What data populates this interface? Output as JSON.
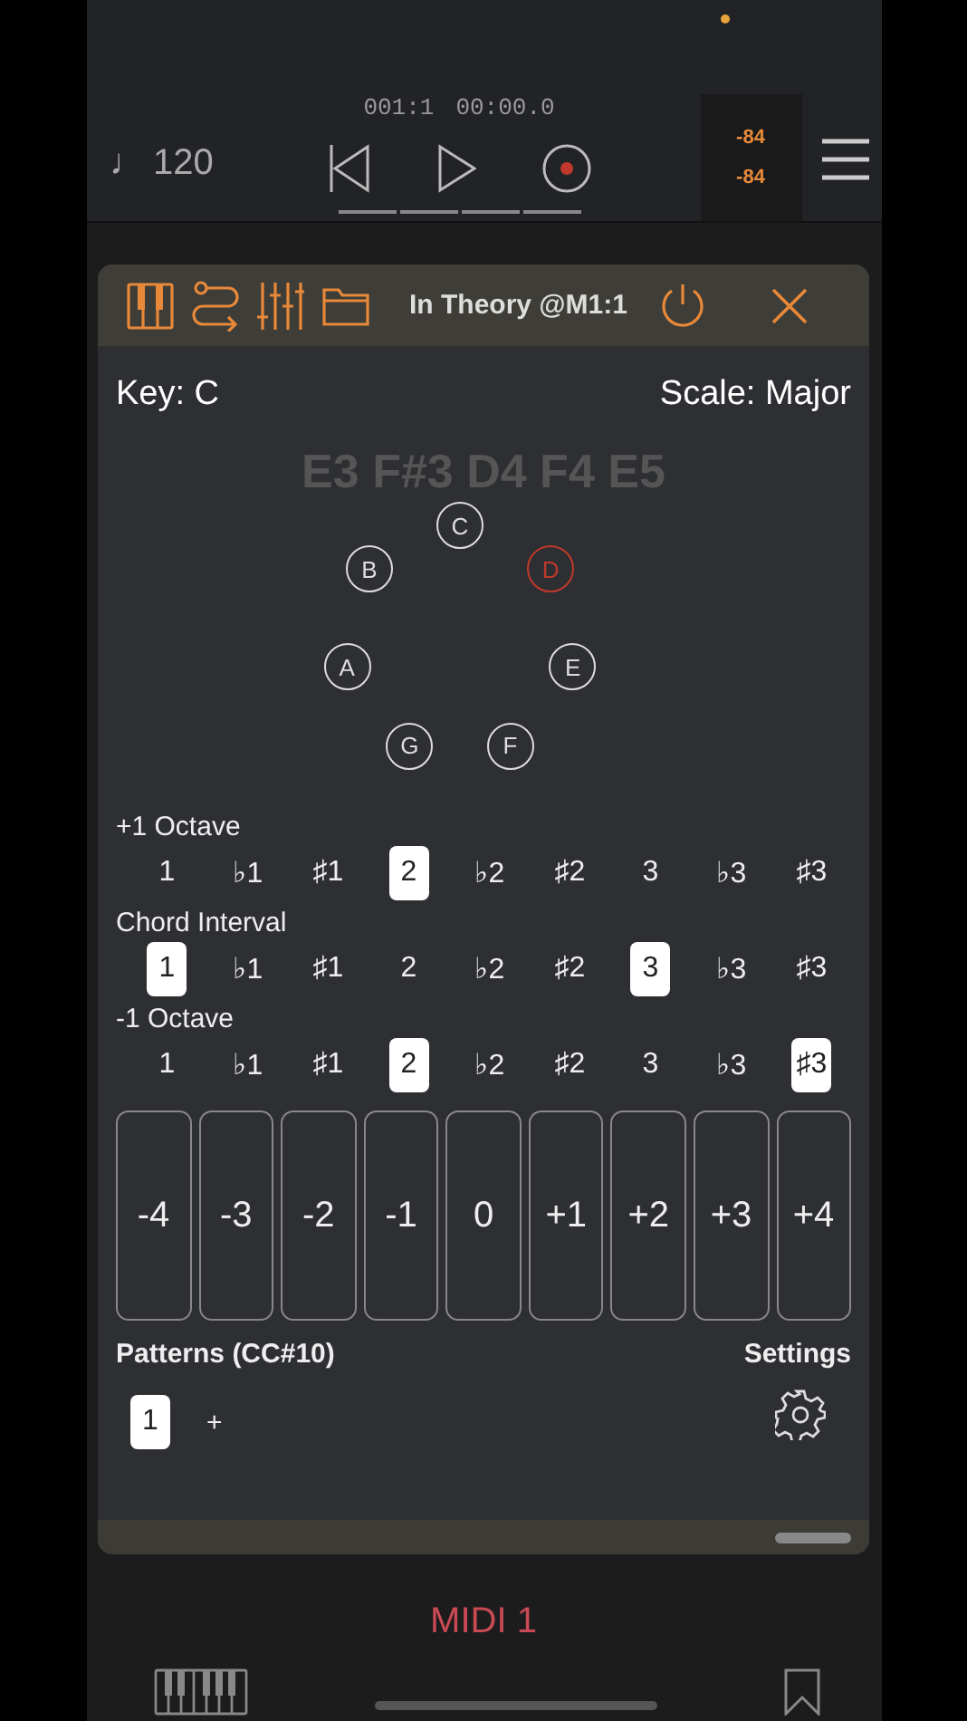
{
  "transport": {
    "tempo_symbol": "♩",
    "tempo": "120",
    "position": "001:1",
    "time": "00:00.0",
    "meters": [
      "-84",
      "-84"
    ]
  },
  "plugin": {
    "title": "In Theory @M1:1",
    "key": "Key: C",
    "scale": "Scale: Major",
    "chord_notes": "E3 F#3 D4 F4 E5",
    "circle": [
      {
        "note": "C",
        "highlighted": false
      },
      {
        "note": "D",
        "highlighted": true
      },
      {
        "note": "E",
        "highlighted": false
      },
      {
        "note": "F",
        "highlighted": false
      },
      {
        "note": "G",
        "highlighted": false
      },
      {
        "note": "A",
        "highlighted": false
      },
      {
        "note": "B",
        "highlighted": false
      }
    ],
    "interval_rows": [
      {
        "label": "+1 Octave",
        "options": [
          {
            "label": "1",
            "selected": false
          },
          {
            "label": "♭1",
            "selected": false
          },
          {
            "label": "♯1",
            "selected": false
          },
          {
            "label": "2",
            "selected": true
          },
          {
            "label": "♭2",
            "selected": false
          },
          {
            "label": "♯2",
            "selected": false
          },
          {
            "label": "3",
            "selected": false
          },
          {
            "label": "♭3",
            "selected": false
          },
          {
            "label": "♯3",
            "selected": false
          }
        ]
      },
      {
        "label": "Chord Interval",
        "options": [
          {
            "label": "1",
            "selected": true
          },
          {
            "label": "♭1",
            "selected": false
          },
          {
            "label": "♯1",
            "selected": false
          },
          {
            "label": "2",
            "selected": false
          },
          {
            "label": "♭2",
            "selected": false
          },
          {
            "label": "♯2",
            "selected": false
          },
          {
            "label": "3",
            "selected": true
          },
          {
            "label": "♭3",
            "selected": false
          },
          {
            "label": "♯3",
            "selected": false
          }
        ]
      },
      {
        "label": "-1 Octave",
        "options": [
          {
            "label": "1",
            "selected": false
          },
          {
            "label": "♭1",
            "selected": false
          },
          {
            "label": "♯1",
            "selected": false
          },
          {
            "label": "2",
            "selected": true
          },
          {
            "label": "♭2",
            "selected": false
          },
          {
            "label": "♯2",
            "selected": false
          },
          {
            "label": "3",
            "selected": false
          },
          {
            "label": "♭3",
            "selected": false
          },
          {
            "label": "♯3",
            "selected": true
          }
        ]
      }
    ],
    "pads": [
      "-4",
      "-3",
      "-2",
      "-1",
      "0",
      "+1",
      "+2",
      "+3",
      "+4"
    ],
    "patterns_label": "Patterns (CC#10)",
    "settings_label": "Settings",
    "patterns": [
      {
        "label": "1",
        "selected": true
      }
    ],
    "add_label": "+"
  },
  "track": "MIDI 1"
}
